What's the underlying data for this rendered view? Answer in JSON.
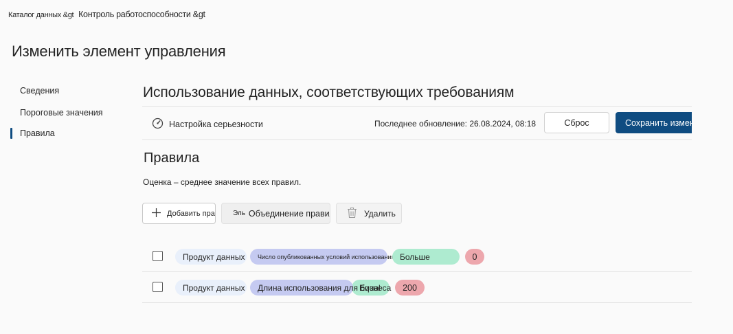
{
  "breadcrumb": {
    "parent": "Каталог данных &gt",
    "current": "Контроль работоспособности &gt"
  },
  "page_title": "Изменить элемент управления",
  "sidebar": {
    "items": [
      {
        "label": "Сведения",
        "active": false
      },
      {
        "label": "Пороговые значения",
        "active": false
      },
      {
        "label": "Правила",
        "active": true
      }
    ]
  },
  "section": {
    "title": "Использование данных, соответствующих требованиям",
    "severity_label": "Настройка серьезности",
    "last_updated": "Последнее обновление: 26.08.2024, 08:18",
    "reset_label": "Сброс",
    "save_label": "Сохранить изменения"
  },
  "rules": {
    "title": "Правила",
    "description": "Оценка – среднее значение всех правил.",
    "toolbar": {
      "add_label": "Добавить правило",
      "merge_prefix": "Эль",
      "merge_label": "Объединение правил",
      "delete_label": "Удалить"
    },
    "rows": [
      {
        "entity": "Продукт данных",
        "attribute": "Число опубликованных условий использования",
        "operator": "Больше",
        "value": "0"
      },
      {
        "entity": "Продукт данных",
        "attribute": "Длина использования для бизнеса",
        "operator": "Equal",
        "value": "200"
      }
    ]
  },
  "colors": {
    "accent": "#0f4c81",
    "entity_pill": "#e9f0fb",
    "attribute_pill": "#c5caf1",
    "operator_pill": "#aeebd0",
    "value_pill": "#eda7ad"
  }
}
